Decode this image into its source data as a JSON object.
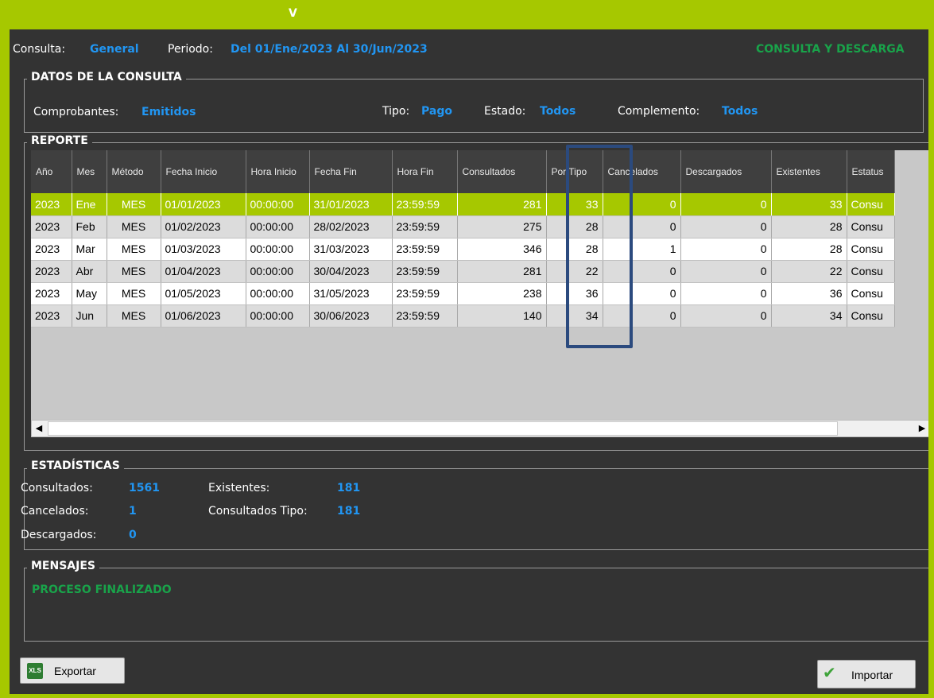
{
  "window": {
    "title": "V"
  },
  "header": {
    "consulta_label": "Consulta:",
    "consulta_value": "General",
    "periodo_label": "Periodo:",
    "periodo_value": "Del 01/Ene/2023 Al 30/Jun/2023",
    "mode_text": "CONSULTA Y DESCARGA"
  },
  "datos": {
    "legend": "DATOS DE LA CONSULTA",
    "comprobantes_label": "Comprobantes:",
    "comprobantes_value": "Emitidos",
    "tipo_label": "Tipo:",
    "tipo_value": "Pago",
    "estado_label": "Estado:",
    "estado_value": "Todos",
    "complemento_label": "Complemento:",
    "complemento_value": "Todos"
  },
  "reporte": {
    "legend": "REPORTE",
    "columns": [
      "Año",
      "Mes",
      "Método",
      "Fecha Inicio",
      "Hora Inicio",
      "Fecha Fin",
      "Hora Fin",
      "Consultados",
      "Por Tipo",
      "Cancelados",
      "Descargados",
      "Existentes",
      "Estatus"
    ],
    "rows": [
      [
        "2023",
        "Ene",
        "MES",
        "01/01/2023",
        "00:00:00",
        "31/01/2023",
        "23:59:59",
        "281",
        "33",
        "0",
        "0",
        "33",
        "Consu"
      ],
      [
        "2023",
        "Feb",
        "MES",
        "01/02/2023",
        "00:00:00",
        "28/02/2023",
        "23:59:59",
        "275",
        "28",
        "0",
        "0",
        "28",
        "Consu"
      ],
      [
        "2023",
        "Mar",
        "MES",
        "01/03/2023",
        "00:00:00",
        "31/03/2023",
        "23:59:59",
        "346",
        "28",
        "1",
        "0",
        "28",
        "Consu"
      ],
      [
        "2023",
        "Abr",
        "MES",
        "01/04/2023",
        "00:00:00",
        "30/04/2023",
        "23:59:59",
        "281",
        "22",
        "0",
        "0",
        "22",
        "Consu"
      ],
      [
        "2023",
        "May",
        "MES",
        "01/05/2023",
        "00:00:00",
        "31/05/2023",
        "23:59:59",
        "238",
        "36",
        "0",
        "0",
        "36",
        "Consu"
      ],
      [
        "2023",
        "Jun",
        "MES",
        "01/06/2023",
        "00:00:00",
        "30/06/2023",
        "23:59:59",
        "140",
        "34",
        "0",
        "0",
        "34",
        "Consu"
      ]
    ],
    "selected_row": 0
  },
  "estadisticas": {
    "legend": "ESTADÍSTICAS",
    "consultados_label": "Consultados:",
    "consultados_value": "1561",
    "cancelados_label": "Cancelados:",
    "cancelados_value": "1",
    "descargados_label": "Descargados:",
    "descargados_value": "0",
    "existentes_label": "Existentes:",
    "existentes_value": "181",
    "consultados_tipo_label": "Consultados Tipo:",
    "consultados_tipo_value": "181"
  },
  "mensajes": {
    "legend": "MENSAJES",
    "text": "PROCESO FINALIZADO"
  },
  "buttons": {
    "exportar": "Exportar",
    "importar": "Importar"
  },
  "icons": {
    "exportar": "xls-icon",
    "importar": "checkmark-icon",
    "scroll_left": "arrow-left-icon",
    "scroll_right": "arrow-right-icon"
  },
  "colors": {
    "accent": "#a6c800",
    "value_blue": "#2196f3",
    "status_green": "#19a34a",
    "panel": "#333333",
    "highlight_box": "#2b4a7e"
  }
}
